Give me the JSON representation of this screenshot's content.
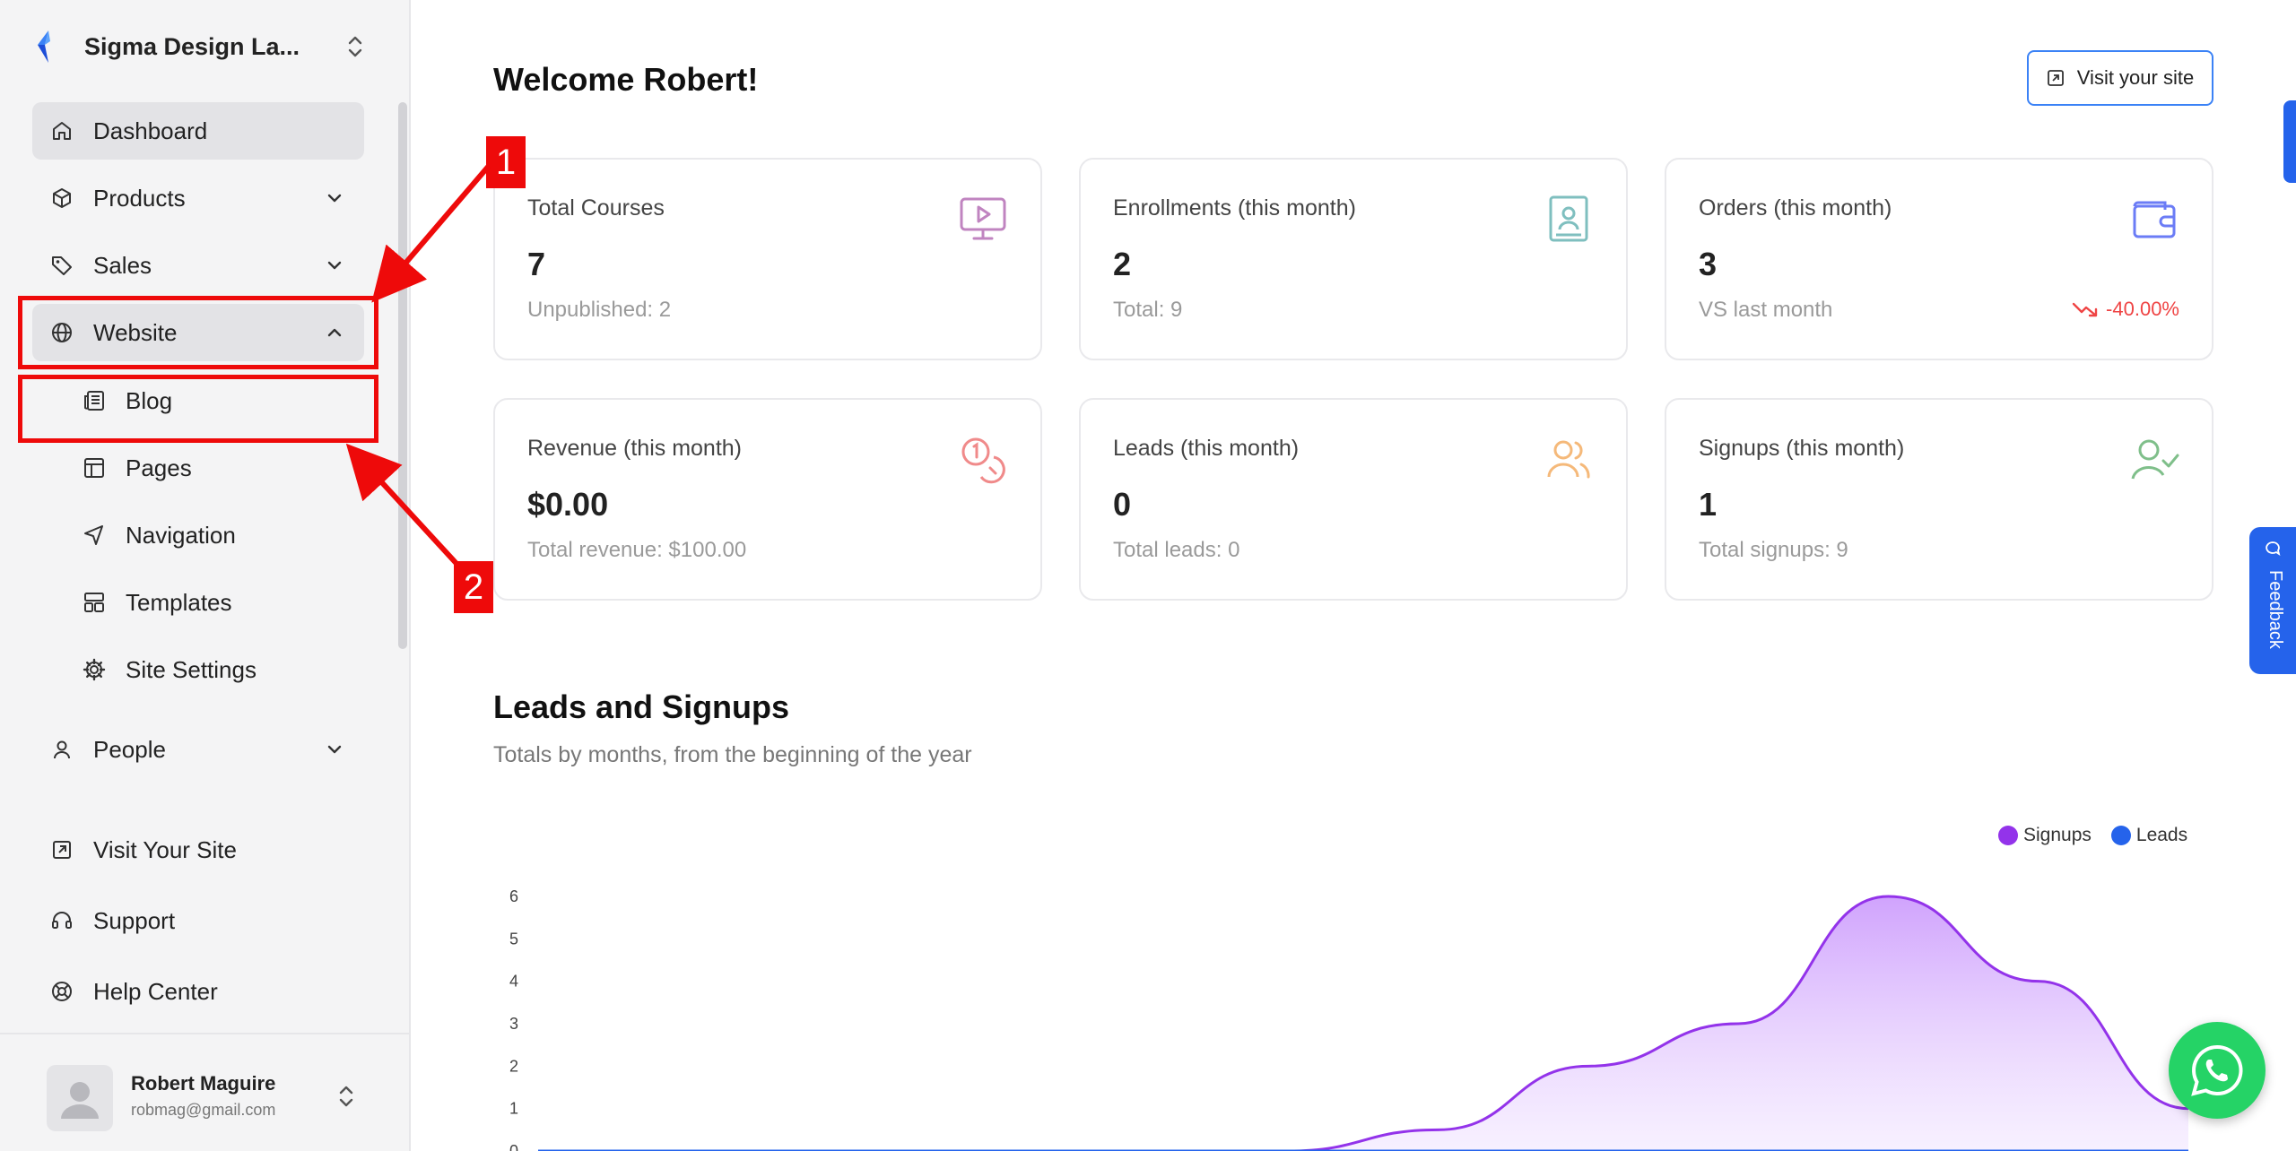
{
  "sidebar": {
    "workspace_name": "Sigma Design La...",
    "nav": {
      "dashboard": "Dashboard",
      "products": "Products",
      "sales": "Sales",
      "website": "Website",
      "people": "People"
    },
    "website_sub": {
      "blog": "Blog",
      "pages": "Pages",
      "navigation": "Navigation",
      "templates": "Templates",
      "site_settings": "Site Settings"
    },
    "bottom": {
      "visit": "Visit Your Site",
      "support": "Support",
      "help": "Help Center"
    },
    "user": {
      "name": "Robert Maguire",
      "email": "robmag@gmail.com"
    }
  },
  "annotations": {
    "badge_1": "1",
    "badge_2": "2",
    "color": "#ee0a0a"
  },
  "main": {
    "welcome": "Welcome Robert!",
    "visit_button": "Visit your site",
    "cards": [
      {
        "title": "Total Courses",
        "value": "7",
        "sub": "Unpublished: 2",
        "icon": "monitor-play-icon",
        "color": "#c084c0"
      },
      {
        "title": "Enrollments (this month)",
        "value": "2",
        "sub": "Total: 9",
        "icon": "contact-book-icon",
        "color": "#7fbfbf"
      },
      {
        "title": "Orders (this month)",
        "value": "3",
        "sub": "VS last month",
        "trend": "-40.00%",
        "icon": "wallet-icon",
        "color": "#6b7cf6"
      },
      {
        "title": "Revenue (this month)",
        "value": "$0.00",
        "sub": "Total revenue: $100.00",
        "icon": "coins-icon",
        "color": "#f08a8a"
      },
      {
        "title": "Leads (this month)",
        "value": "0",
        "sub": "Total leads: 0",
        "icon": "users-icon",
        "color": "#f5b97a"
      },
      {
        "title": "Signups (this month)",
        "value": "1",
        "sub": "Total signups: 9",
        "icon": "user-check-icon",
        "color": "#7fbf8a"
      }
    ],
    "section_title": "Leads and Signups",
    "section_sub": "Totals by months, from the beginning of the year"
  },
  "widgets": {
    "feedback": "Feedback"
  },
  "chart_data": {
    "type": "area",
    "title": "Leads and Signups",
    "subtitle": "Totals by months, from the beginning of the year",
    "ylim": [
      0,
      6
    ],
    "y_ticks": [
      6,
      5,
      4,
      3,
      2,
      1,
      0
    ],
    "legend": "top-right",
    "series": [
      {
        "name": "Signups",
        "color": "#9333ea",
        "values": [
          0,
          0,
          0,
          0,
          0,
          0,
          0.5,
          2,
          3,
          6,
          4,
          1
        ]
      },
      {
        "name": "Leads",
        "color": "#2563eb",
        "values": [
          0,
          0,
          0,
          0,
          0,
          0,
          0,
          0,
          0,
          0,
          0,
          0
        ]
      }
    ]
  }
}
